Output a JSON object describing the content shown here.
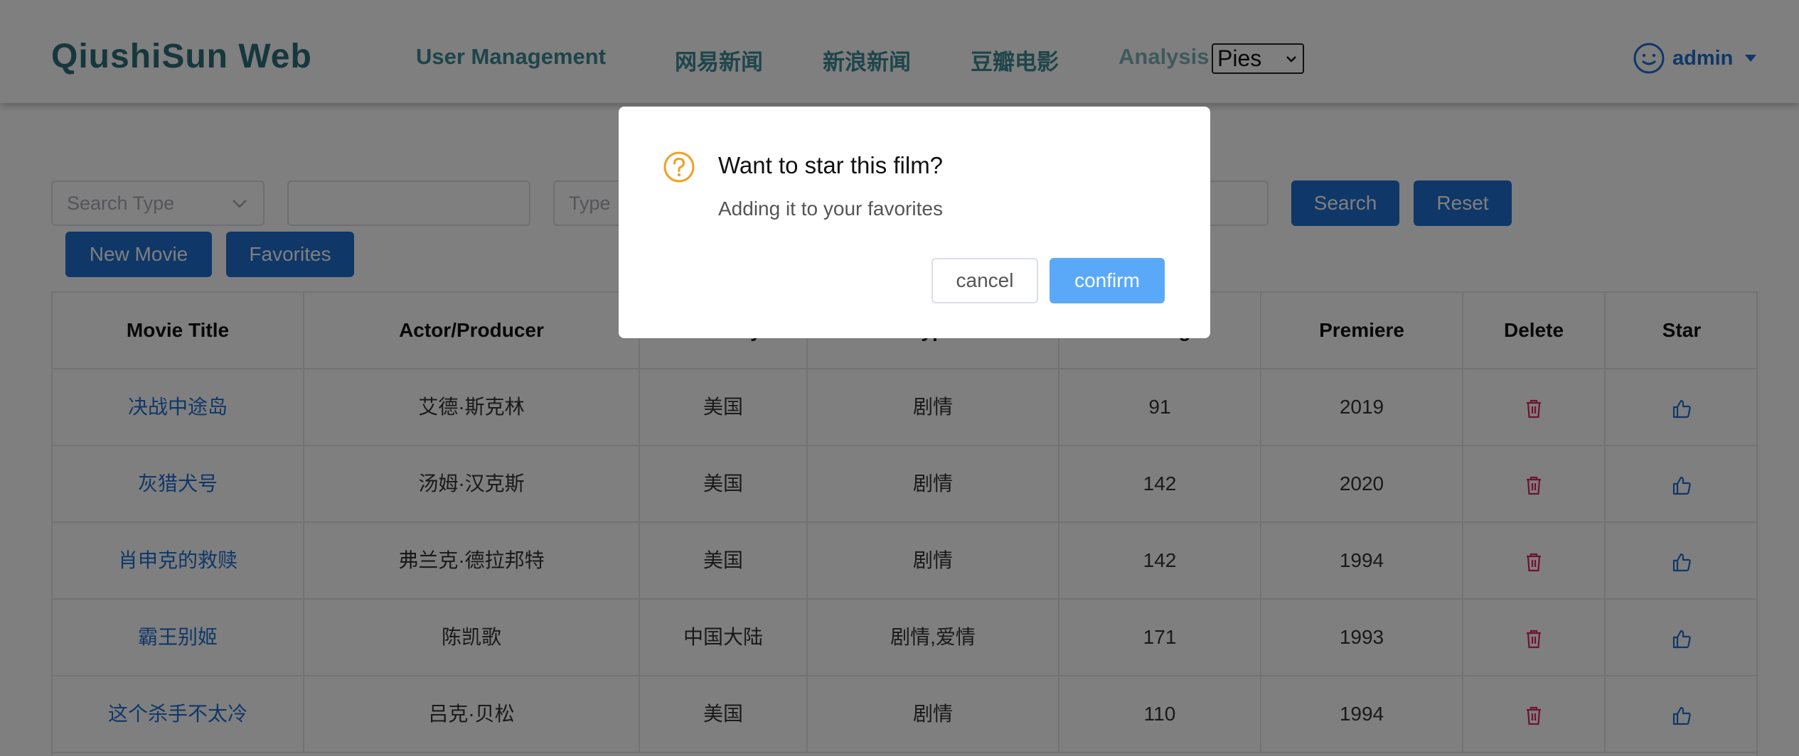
{
  "header": {
    "brand": "QiushiSun Web",
    "nav": [
      {
        "label": "User Management"
      },
      {
        "label": "网易新闻"
      },
      {
        "label": "新浪新闻"
      },
      {
        "label": "豆瓣电影"
      },
      {
        "label": "Analysis"
      }
    ],
    "analysis_select_value": "Pies",
    "user_name": "admin"
  },
  "search": {
    "type_placeholder": "Search Type",
    "keyword_value": "",
    "type_field_placeholder": "Type",
    "search_label": "Search",
    "reset_label": "Reset",
    "new_movie_label": "New Movie",
    "favorites_label": "Favorites"
  },
  "table": {
    "columns": [
      "Movie Title",
      "Actor/Producer",
      "Country",
      "Type",
      "Rating",
      "Premiere",
      "Delete",
      "Star"
    ],
    "rows": [
      {
        "title": "决战中途岛",
        "actor": "艾德·斯克林",
        "country": "美国",
        "type": "剧情",
        "rating": "91",
        "premiere": "2019"
      },
      {
        "title": "灰猎犬号",
        "actor": "汤姆·汉克斯",
        "country": "美国",
        "type": "剧情",
        "rating": "142",
        "premiere": "2020"
      },
      {
        "title": "肖申克的救赎",
        "actor": "弗兰克·德拉邦特",
        "country": "美国",
        "type": "剧情",
        "rating": "142",
        "premiere": "1994"
      },
      {
        "title": "霸王别姬",
        "actor": "陈凯歌",
        "country": "中国大陆",
        "type": "剧情,爱情",
        "rating": "171",
        "premiere": "1993"
      },
      {
        "title": "这个杀手不太冷",
        "actor": "吕克·贝松",
        "country": "美国",
        "type": "剧情",
        "rating": "110",
        "premiere": "1994"
      }
    ]
  },
  "dialog": {
    "title": "Want to star this film?",
    "message": "Adding it to your favorites",
    "cancel_label": "cancel",
    "confirm_label": "confirm"
  },
  "colors": {
    "primary": "#1f6fd0",
    "brand": "#2d6f7a",
    "delete": "#e0245e",
    "confirm": "#5aa9f8",
    "warning": "#f0a020"
  }
}
